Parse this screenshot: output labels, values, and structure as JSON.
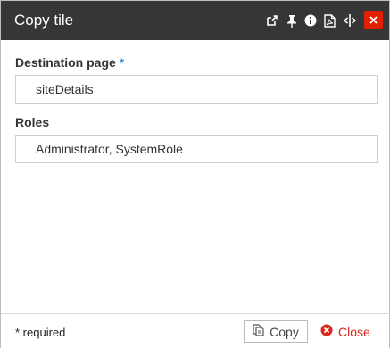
{
  "dialog": {
    "title": "Copy tile",
    "toolbar_icons": [
      "pop-out-icon",
      "pin-icon",
      "info-icon",
      "pdf-icon",
      "resize-width-icon",
      "close-icon"
    ]
  },
  "form": {
    "destination": {
      "label": "Destination page",
      "required_mark": "*",
      "value": "siteDetails"
    },
    "roles": {
      "label": "Roles",
      "value": "Administrator, SystemRole"
    }
  },
  "footer": {
    "required_note": "* required",
    "copy_label": "Copy",
    "close_label": "Close"
  },
  "colors": {
    "titlebar": "#363636",
    "close_button": "#e02000",
    "required_accent": "#3a8fd9",
    "close_text": "#d9281a"
  }
}
